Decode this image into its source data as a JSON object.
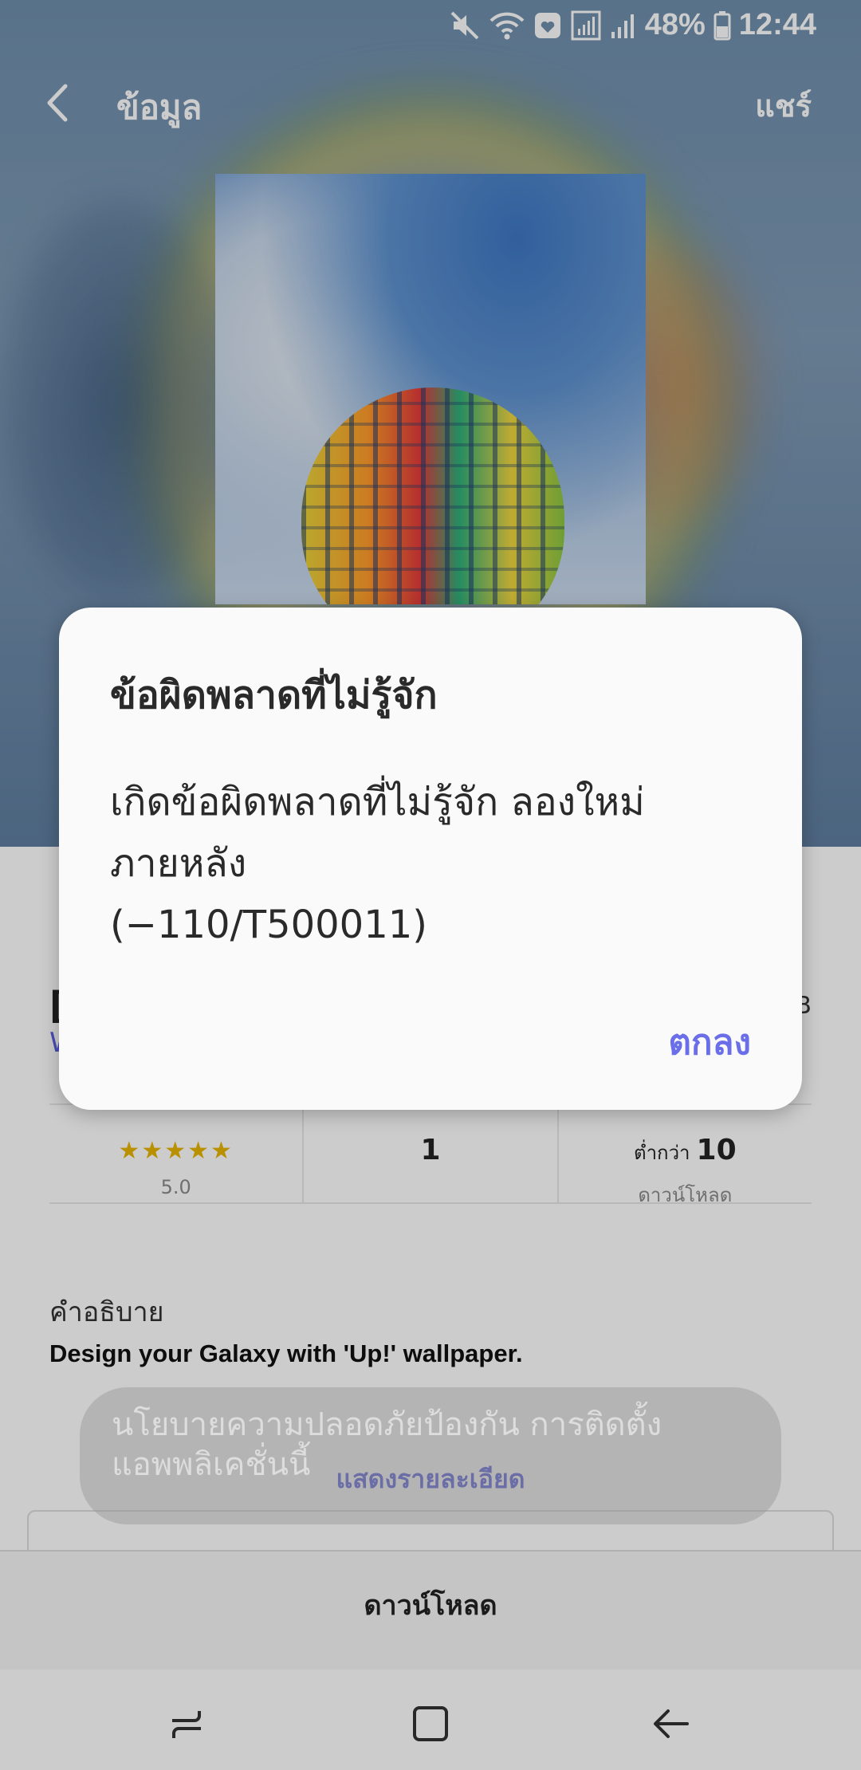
{
  "status_bar": {
    "battery": "48%",
    "time": "12:44",
    "icons": [
      "mute-icon",
      "wifi-icon",
      "notification-icon",
      "signal-icon",
      "signal-icon",
      "battery-icon"
    ]
  },
  "top_bar": {
    "title": "ข้อมูล",
    "share": "แชร์",
    "back_icon": "chevron-left-icon"
  },
  "app": {
    "title_partial": "[",
    "seller_partial": "W",
    "size_partial": "B"
  },
  "stats": {
    "rating_stars": "★★★★★",
    "rating_value": "5.0",
    "reviews": "1",
    "downloads_prefix": "ต่ำกว่า",
    "downloads_value": "10",
    "downloads_label": "ดาวน์โหลด"
  },
  "description": {
    "label": "คำอธิบาย",
    "text": "Design your Galaxy with 'Up!' wallpaper.",
    "details_link": "แสดงรายละเอียด"
  },
  "toast": {
    "text": "นโยบายความปลอดภัยป้องกัน การติดตั้งแอพพลิเคชั่นนี้",
    "line1": "นโยบายความปลอดภัยป้องกัน การติดตั้ง",
    "line2": "แอพพลิเคชั่นนี้"
  },
  "download": {
    "label": "ดาวน์โหลด"
  },
  "dialog": {
    "title": "ข้อผิดพลาดที่ไม่รู้จัก",
    "message_line1": "เกิดข้อผิดพลาดที่ไม่รู้จัก ลองใหม่",
    "message_line2": "ภายหลัง",
    "message_line3": "(−110/T500011)",
    "ok": "ตกลง"
  },
  "nav_bar": {
    "icons": [
      "recents-icon",
      "home-icon",
      "back-arrow-icon"
    ]
  },
  "colors": {
    "accent": "#6a6ee8",
    "star": "#e8b400"
  }
}
